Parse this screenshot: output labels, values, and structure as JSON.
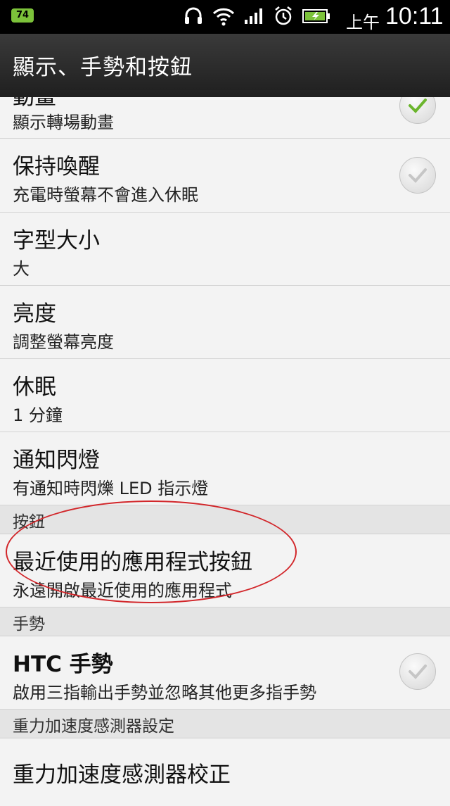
{
  "status_bar": {
    "notification_count": "74",
    "time_prefix": "上午",
    "time": "10:11",
    "icons": [
      "headset-icon",
      "wifi-icon",
      "signal-icon",
      "alarm-icon",
      "battery-icon"
    ]
  },
  "header": {
    "title": "顯示、手勢和按鈕"
  },
  "rows": {
    "animation": {
      "title": "動畫",
      "subtitle": "顯示轉場動畫",
      "checked": true
    },
    "stay_awake": {
      "title": "保持喚醒",
      "subtitle": "充電時螢幕不會進入休眠",
      "checked": true
    },
    "font_size": {
      "title": "字型大小",
      "subtitle": "大"
    },
    "brightness": {
      "title": "亮度",
      "subtitle": "調整螢幕亮度"
    },
    "sleep": {
      "title": "休眠",
      "subtitle": "1 分鐘"
    },
    "notification_light": {
      "title": "通知閃燈",
      "subtitle": "有通知時閃爍 LED 指示燈"
    },
    "recent_apps_button": {
      "title": "最近使用的應用程式按鈕",
      "subtitle": "永遠開啟最近使用的應用程式"
    },
    "htc_gestures": {
      "title": "HTC 手勢",
      "subtitle": "啟用三指輸出手勢並忽略其他更多指手勢",
      "checked": true
    },
    "gsensor_calibration": {
      "title": "重力加速度感測器校正"
    }
  },
  "sections": {
    "buttons": "按鈕",
    "gestures": "手勢",
    "gsensor": "重力加速度感測器設定"
  },
  "colors": {
    "accent_green": "#7cc23a",
    "annotation_red": "#d2262a"
  }
}
